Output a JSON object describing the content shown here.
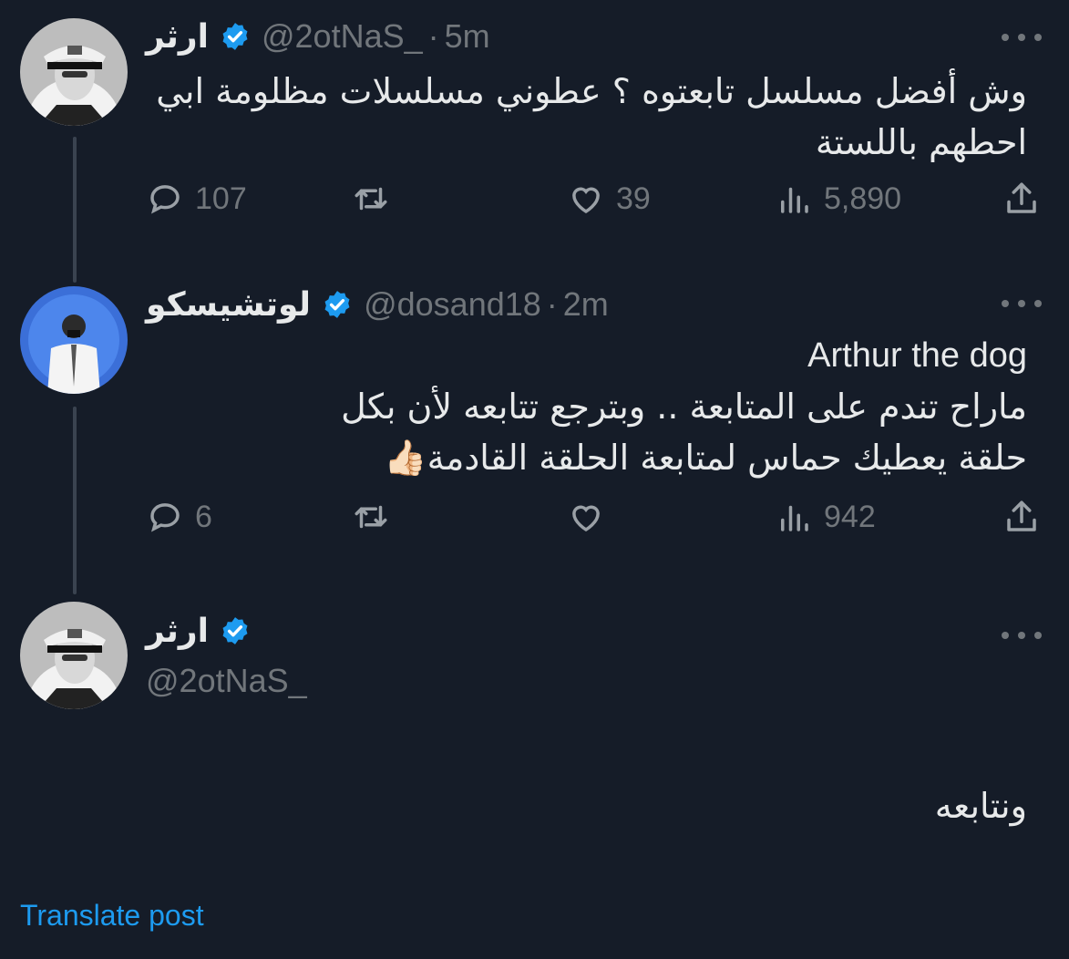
{
  "thread_line_color": "#3a4350",
  "accent_color": "#1d9bf0",
  "tweets": [
    {
      "name": "ارثر",
      "handle": "@2otNaS_",
      "separator": "·",
      "time": "5m",
      "text_lines": [
        "وش أفضل مسلسل تابعتوه ؟ عطوني مسلسلات مظلومة ابي",
        "احطهم باللستة"
      ],
      "actions": {
        "replies": "107",
        "retweets": "",
        "likes": "39",
        "views": "5,890"
      }
    },
    {
      "name": "لوتشيسكو",
      "handle": "@dosand18",
      "separator": "·",
      "time": "2m",
      "text_ltr_line": "Arthur the dog",
      "text_lines": [
        "ماراح تندم على المتابعة .. وبترجع تتابعه لأن بكل",
        "حلقة يعطيك حماس لمتابعة الحلقة القادمة👍🏻"
      ],
      "actions": {
        "replies": "6",
        "retweets": "",
        "likes": "",
        "views": "942"
      }
    },
    {
      "name": "ارثر",
      "handle": "@2otNaS_",
      "text": "ونتابعه"
    }
  ],
  "translate_label": "Translate post",
  "icons": [
    "verified-badge-icon",
    "more-icon",
    "reply-icon",
    "retweet-icon",
    "like-icon",
    "views-icon",
    "share-icon"
  ]
}
